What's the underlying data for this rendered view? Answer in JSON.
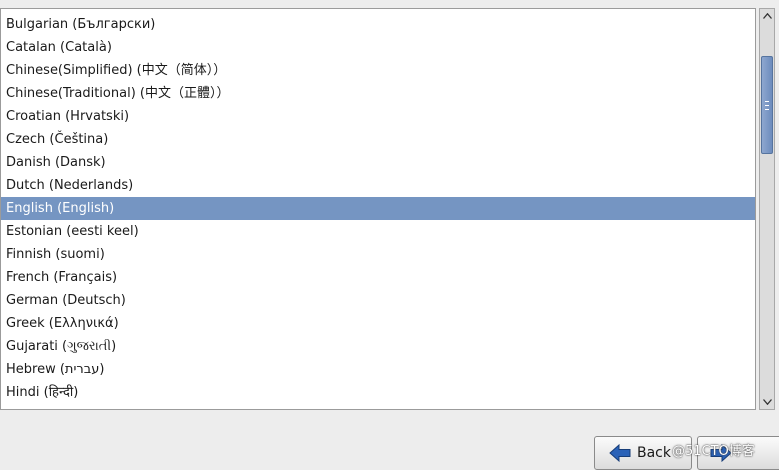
{
  "languages": [
    {
      "label": "Bulgarian (Български)",
      "selected": false
    },
    {
      "label": "Catalan (Català)",
      "selected": false
    },
    {
      "label": "Chinese(Simplified) (中文（简体））",
      "selected": false
    },
    {
      "label": "Chinese(Traditional) (中文（正體））",
      "selected": false
    },
    {
      "label": "Croatian (Hrvatski)",
      "selected": false
    },
    {
      "label": "Czech (Čeština)",
      "selected": false
    },
    {
      "label": "Danish (Dansk)",
      "selected": false
    },
    {
      "label": "Dutch (Nederlands)",
      "selected": false
    },
    {
      "label": "English (English)",
      "selected": true
    },
    {
      "label": "Estonian (eesti keel)",
      "selected": false
    },
    {
      "label": "Finnish (suomi)",
      "selected": false
    },
    {
      "label": "French (Français)",
      "selected": false
    },
    {
      "label": "German (Deutsch)",
      "selected": false
    },
    {
      "label": "Greek (Ελληνικά)",
      "selected": false
    },
    {
      "label": "Gujarati (ગુજરાતી)",
      "selected": false
    },
    {
      "label": "Hebrew (עברית)",
      "selected": false
    },
    {
      "label": "Hindi (हिन्दी)",
      "selected": false
    }
  ],
  "buttons": {
    "back_label": "Back",
    "next_label": ""
  },
  "watermark": "@51CTO博客",
  "colors": {
    "selection": "#7595c2",
    "selection_text": "#ffffff",
    "back_arrow": "#2a62b8",
    "scroll_thumb": "#6d8cbd"
  },
  "icons": {
    "back": "arrow-left-icon",
    "next": "arrow-right-icon",
    "scroll_up": "triangle-up-icon",
    "scroll_down": "triangle-down-icon"
  }
}
